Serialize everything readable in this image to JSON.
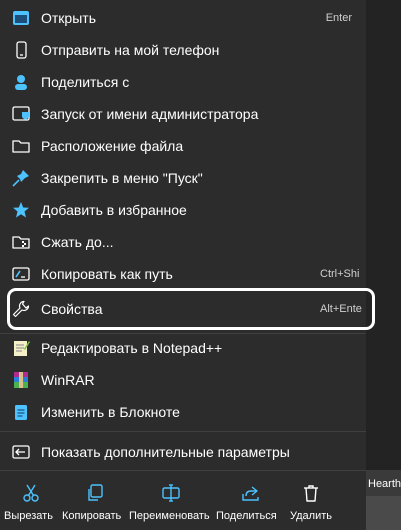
{
  "menu": {
    "items": [
      {
        "label": "Открыть",
        "shortcut": "Enter",
        "icon": "open-app-icon"
      },
      {
        "label": "Отправить на мой телефон",
        "icon": "phone-icon"
      },
      {
        "label": "Поделиться с",
        "icon": "share-icon"
      },
      {
        "label": "Запуск от имени администратора",
        "icon": "shield-icon"
      },
      {
        "label": "Расположение файла",
        "icon": "folder-icon"
      },
      {
        "label": "Закрепить в меню \"Пуск\"",
        "icon": "pin-icon"
      },
      {
        "label": "Добавить в избранное",
        "icon": "star-icon"
      },
      {
        "label": "Сжать до...",
        "icon": "archive-folder-icon"
      },
      {
        "label": "Копировать как путь",
        "shortcut": "Ctrl+Shi",
        "icon": "copy-path-icon"
      },
      {
        "label": "Свойства",
        "shortcut": "Alt+Ente",
        "icon": "wrench-icon"
      },
      {
        "label": "Редактировать в Notepad++",
        "icon": "notepadpp-icon"
      },
      {
        "label": "WinRAR",
        "icon": "winrar-icon"
      },
      {
        "label": "Изменить в Блокноте",
        "icon": "notepad-icon"
      },
      {
        "label": "Показать дополнительные параметры",
        "icon": "more-options-icon"
      }
    ],
    "bottom_actions": [
      {
        "label": "Вырезать",
        "icon": "scissors-icon"
      },
      {
        "label": "Копировать",
        "icon": "copy-icon"
      },
      {
        "label": "Переименовать",
        "icon": "rename-icon"
      },
      {
        "label": "Поделиться",
        "icon": "share-icon"
      },
      {
        "label": "Удалить",
        "icon": "trash-icon"
      }
    ]
  },
  "background": {
    "thumbnail_label": "Hearth"
  },
  "colors": {
    "menu_bg": "#2c2c2c",
    "accent_blue": "#4cc2ff",
    "highlight_border": "#ffffff",
    "separator": "#3f3f3f"
  }
}
